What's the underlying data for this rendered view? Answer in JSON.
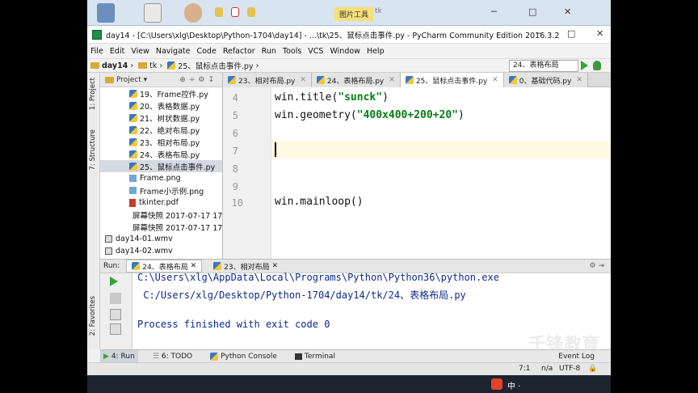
{
  "colors": {
    "accent": "#3aa23a",
    "string": "#067d17",
    "console_text": "#0c2a8a",
    "selection": "#d5d9e2"
  },
  "desktop": {
    "pic_tools_tab": "图片工具",
    "tk_tab": "tk"
  },
  "window": {
    "title": "day14 - [C:\\Users\\xlg\\Desktop\\Python-1704\\day14] - ...\\tk\\25、鼠标点击事件.py - PyCharm Community Edition 2016.3.2"
  },
  "menu": [
    "File",
    "Edit",
    "View",
    "Navigate",
    "Code",
    "Refactor",
    "Run",
    "Tools",
    "VCS",
    "Window",
    "Help"
  ],
  "breadcrumb": [
    "day14",
    "tk",
    "25、鼠标点击事件.py"
  ],
  "run_config": "24、表格布局",
  "left_strip": {
    "project": "1: Project",
    "structure": "7: Structure",
    "favorites": "2: Favorites"
  },
  "project_panel": {
    "header": "Project",
    "items": [
      {
        "label": "19、Frame控件.py",
        "type": "py"
      },
      {
        "label": "20、表格数据.py",
        "type": "py"
      },
      {
        "label": "21、树状数据.py",
        "type": "py"
      },
      {
        "label": "22、绝对布局.py",
        "type": "py"
      },
      {
        "label": "23、相对布局.py",
        "type": "py"
      },
      {
        "label": "24、表格布局.py",
        "type": "py"
      },
      {
        "label": "25、鼠标点击事件.py",
        "type": "py"
      },
      {
        "label": "Frame.png",
        "type": "img"
      },
      {
        "label": "Frame小示例.png",
        "type": "img"
      },
      {
        "label": "tkinter.pdf",
        "type": "pdf"
      },
      {
        "label": "屏幕快照 2017-07-17 17",
        "type": "img"
      },
      {
        "label": "屏幕快照 2017-07-17 17",
        "type": "img"
      },
      {
        "label": "day14-01.wmv",
        "type": "wmv"
      },
      {
        "label": "day14-02.wmv",
        "type": "wmv"
      }
    ]
  },
  "editor_tabs": [
    {
      "label": "23、相对布局.py",
      "active": false
    },
    {
      "label": "24、表格布局.py",
      "active": false
    },
    {
      "label": "25、鼠标点击事件.py",
      "active": true
    },
    {
      "label": "0、基础代码.py",
      "active": false
    }
  ],
  "code": {
    "line_numbers": [
      "4",
      "5",
      "6",
      "7",
      "8",
      "9",
      "10"
    ],
    "l4_pre": "win.title(",
    "l4_str": "\"sunck\"",
    "l4_post": ")",
    "l5_pre": "win.geometry(",
    "l5_str": "\"400x400+200+20\"",
    "l5_post": ")",
    "l10": "win.mainloop()"
  },
  "run_panel": {
    "label": "Run:",
    "tabs": [
      "24、表格布局",
      "23、相对布局"
    ],
    "console": [
      "C:\\Users\\xlg\\AppData\\Local\\Programs\\Python\\Python36\\python.exe",
      " C:/Users/xlg/Desktop/Python-1704/day14/tk/24、表格布局.py",
      "",
      "Process finished with exit code 0"
    ]
  },
  "bottom_tools": [
    "4: Run",
    "6: TODO",
    "Python Console",
    "Terminal"
  ],
  "event_log": "Event Log",
  "status": {
    "position": "7:1",
    "line_sep": "n/a",
    "encoding": "UTF-8"
  },
  "watermark": "千锋教育"
}
